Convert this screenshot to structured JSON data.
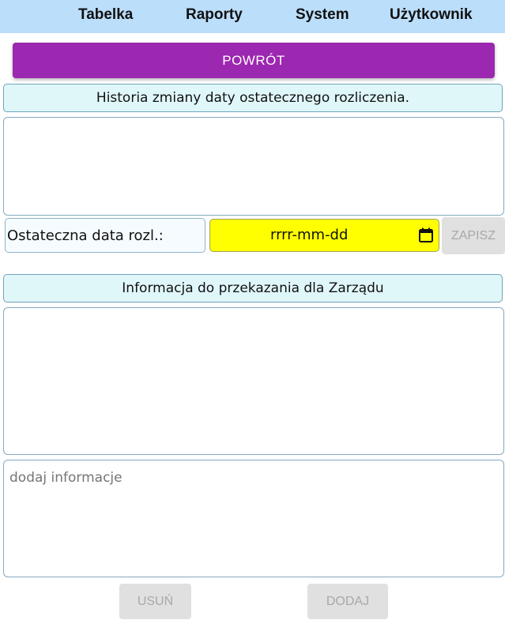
{
  "nav": {
    "items": [
      {
        "label": "Tabelka"
      },
      {
        "label": "Raporty"
      },
      {
        "label": "System"
      },
      {
        "label": "Użytkownik"
      }
    ]
  },
  "back_button": {
    "label": "POWRÓT"
  },
  "history_section": {
    "title": "Historia zmiany daty ostatecznego rozliczenia."
  },
  "final_date": {
    "label": "Ostateczna data rozl.:",
    "placeholder": "rrrr-mm-dd",
    "save_label": "ZAPISZ",
    "highlight_color": "#ffff00"
  },
  "info_section": {
    "title": "Informacja do przekazania dla Zarządu",
    "add_placeholder": "dodaj informacje"
  },
  "actions": {
    "delete_label": "USUŃ",
    "add_label": "DODAJ"
  },
  "colors": {
    "nav_bg": "#bbdefb",
    "accent": "#9c27b0",
    "section_bg": "#e0f7fa",
    "disabled_bg": "#e0e0e0"
  }
}
